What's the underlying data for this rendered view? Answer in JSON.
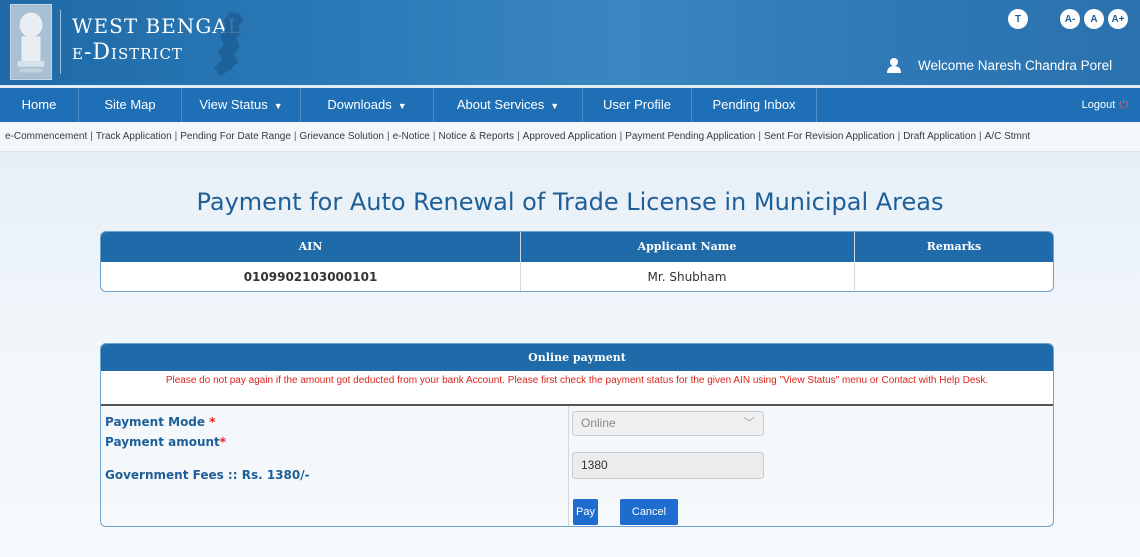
{
  "header": {
    "logo_line1": "West Bengal",
    "logo_line2": "e-District",
    "font_controls": [
      "T",
      "A-",
      "A",
      "A+"
    ],
    "welcome_text": "Welcome Naresh Chandra Porel"
  },
  "nav": {
    "items": [
      {
        "label": "Home"
      },
      {
        "label": "Site Map"
      },
      {
        "label": "View Status",
        "dropdown": true
      },
      {
        "label": "Downloads",
        "dropdown": true
      },
      {
        "label": "About Services",
        "dropdown": true
      },
      {
        "label": "User Profile"
      },
      {
        "label": "Pending Inbox"
      }
    ],
    "logout_label": "Logout"
  },
  "sublinks": [
    "e-Commencement",
    "Track Application",
    "Pending For Date Range",
    "Grievance Solution",
    "e-Notice",
    "Notice & Reports",
    "Approved Application",
    "Payment Pending Application",
    "Sent For Revision Application",
    "Draft Application",
    "A/C Stmnt"
  ],
  "page_title": "Payment for Auto Renewal of Trade License in Municipal Areas",
  "application_table": {
    "headers": [
      "AIN",
      "Applicant Name",
      "Remarks"
    ],
    "row": [
      "0109902103000101",
      "Mr. Shubham",
      ""
    ]
  },
  "payment": {
    "header": "Online payment",
    "warning": "Please do not pay again if the amount got deducted from your bank Account. Please first check the payment status for the given AIN using \"View Status\" menu or Contact with Help Desk.",
    "mode_label": "Payment Mode ",
    "amount_label": "Payment amount",
    "required_mark": "*",
    "fees_label": "Government Fees :: Rs. 1380/-",
    "mode_value": "Online",
    "amount_value": "1380",
    "pay_label": "Pay",
    "cancel_label": "Cancel"
  },
  "colors": {
    "brand_blue": "#1f6aa8",
    "nav_blue": "#1e6fb5",
    "warning_red": "#d9261c",
    "button_blue": "#1f6ccf"
  }
}
